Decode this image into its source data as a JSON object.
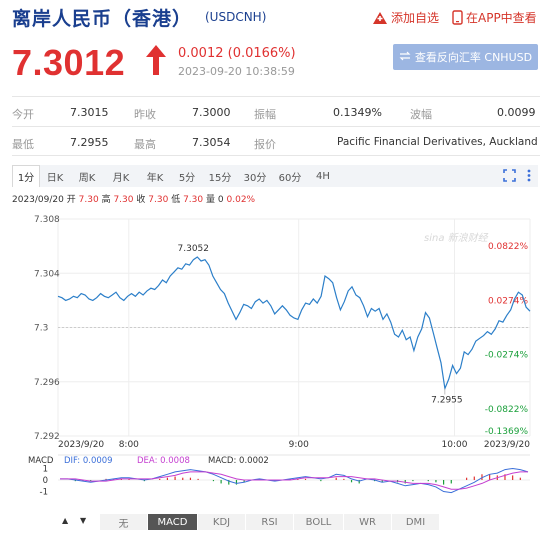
{
  "header": {
    "title": "离岸人民币（香港）",
    "symbol": "(USDCNH)",
    "add_watchlist": "添加自选",
    "app_view": "在APP中查看"
  },
  "quote": {
    "price": "7.3012",
    "change": "0.0012 (0.0166%)",
    "timestamp": "2023-09-20 10:38:59",
    "reverse_label": "查看反向汇率 CNHUSD",
    "up_color": "#e03131"
  },
  "stats": [
    [
      {
        "label": "今开",
        "value": "7.3015"
      },
      {
        "label": "昨收",
        "value": "7.3000"
      },
      {
        "label": "振幅",
        "value": "0.1349%"
      },
      {
        "label": "波幅",
        "value": "0.0099"
      }
    ],
    [
      {
        "label": "最低",
        "value": "7.2955"
      },
      {
        "label": "最高",
        "value": "7.3054"
      },
      {
        "label": "报价",
        "value": "Pacific Financial Derivatives, Auckland"
      }
    ]
  ],
  "tabs": [
    "1分",
    "日K",
    "周K",
    "月K",
    "年K",
    "5分",
    "15分",
    "30分",
    "60分",
    "4H"
  ],
  "active_tab": "1分",
  "info": {
    "date": "2023/09/20",
    "open_label": "开",
    "open": "7.30",
    "high_label": "高",
    "high": "7.30",
    "close_label": "收",
    "close": "7.30",
    "low_label": "低",
    "low": "7.30",
    "vol_label": "量",
    "vol": "0",
    "pct": "0.02%"
  },
  "chart_data": {
    "type": "line",
    "title": "",
    "y_ticks": [
      "7.308",
      "7.304",
      "7.3",
      "7.296",
      "7.292"
    ],
    "y_tick_values": [
      7.308,
      7.304,
      7.3,
      7.296,
      7.292
    ],
    "ylim": [
      7.292,
      7.308
    ],
    "pct_ticks": [
      "0.0822%",
      "0.0274%",
      "-0.0274%",
      "-0.0822%",
      "-0.1369%"
    ],
    "pct_tick_values": [
      7.306,
      7.302,
      7.298,
      7.294,
      7.292
    ],
    "x_ticks": [
      "2023/9/20",
      "8:00",
      "9:00",
      "10:00",
      "2023/9/20"
    ],
    "x_tick_positions": [
      0,
      0.15,
      0.51,
      0.84,
      1.0
    ],
    "high_label": "7.3052",
    "low_label": "7.2955",
    "prev_close": 7.3,
    "series": [
      {
        "values": [
          7.3023,
          7.3022,
          7.302,
          7.3021,
          7.3023,
          7.3022,
          7.3025,
          7.3024,
          7.3021,
          7.302,
          7.3022,
          7.3025,
          7.3023,
          7.3022,
          7.3024,
          7.3026,
          7.3022,
          7.302,
          7.3023,
          7.3025,
          7.3023,
          7.3026,
          7.3024,
          7.3027,
          7.3029,
          7.3028,
          7.3031,
          7.3035,
          7.3033,
          7.3038,
          7.3041,
          7.3044,
          7.3043,
          7.3047,
          7.3046,
          7.305,
          7.3052,
          7.3049,
          7.305,
          7.3046,
          7.3038,
          7.3033,
          7.3028,
          7.3025,
          7.3018,
          7.3012,
          7.3006,
          7.3011,
          7.3017,
          7.3016,
          7.3014,
          7.3019,
          7.3021,
          7.3018,
          7.302,
          7.3016,
          7.301,
          7.3013,
          7.3016,
          7.3013,
          7.3009,
          7.3007,
          7.3006,
          7.3013,
          7.3018,
          7.3017,
          7.3021,
          7.3018,
          7.3023,
          7.3038,
          7.3036,
          7.3033,
          7.3022,
          7.3013,
          7.3019,
          7.3027,
          7.303,
          7.3024,
          7.3022,
          7.3016,
          7.3008,
          7.3014,
          7.3012,
          7.3014,
          7.3006,
          7.301,
          7.3004,
          7.2995,
          7.2993,
          7.2998,
          7.2991,
          7.2993,
          7.2983,
          7.2993,
          7.2999,
          7.3011,
          7.3007,
          7.2996,
          7.2985,
          7.2974,
          7.2955,
          7.2962,
          7.2972,
          7.2966,
          7.297,
          7.2982,
          7.298,
          7.2984,
          7.299,
          7.2992,
          7.2994,
          7.2997,
          7.2995,
          7.2999,
          7.3005,
          7.3004,
          7.3009,
          7.3013,
          7.3021,
          7.3026,
          7.3024,
          7.3015,
          7.3012
        ]
      }
    ]
  },
  "macd": {
    "label": "MACD",
    "dif_label": "DIF: 0.0009",
    "dea_label": "DEA: 0.0008",
    "macd_label": "MACD: 0.0002",
    "y_ticks": [
      "1",
      "0",
      "-1"
    ],
    "dif": [
      0.1,
      0.1,
      0.0,
      -0.1,
      -0.2,
      -0.1,
      0.0,
      0.1,
      0.2,
      0.2,
      0.1,
      0.0,
      0.1,
      0.3,
      0.5,
      0.7,
      0.8,
      0.9,
      0.8,
      0.7,
      0.5,
      0.2,
      -0.1,
      -0.3,
      -0.2,
      0.0,
      0.1,
      0.0,
      -0.1,
      0.0,
      0.1,
      0.2,
      0.3,
      0.2,
      0.1,
      0.2,
      0.5,
      0.4,
      0.1,
      -0.1,
      0.1,
      0.0,
      -0.2,
      -0.1,
      -0.3,
      -0.5,
      -0.4,
      -0.3,
      -0.4,
      -0.6,
      -1.0,
      -1.1,
      -0.8,
      -0.5,
      -0.2,
      0.2,
      0.5,
      0.6,
      0.9,
      1.0,
      0.9,
      0.7
    ],
    "dea": [
      0.1,
      0.1,
      0.1,
      0.0,
      -0.1,
      -0.1,
      -0.1,
      0.0,
      0.1,
      0.1,
      0.1,
      0.1,
      0.1,
      0.2,
      0.3,
      0.4,
      0.6,
      0.7,
      0.7,
      0.7,
      0.6,
      0.5,
      0.3,
      0.1,
      0.0,
      0.0,
      0.0,
      0.0,
      0.0,
      0.0,
      0.0,
      0.1,
      0.2,
      0.2,
      0.2,
      0.2,
      0.3,
      0.3,
      0.3,
      0.2,
      0.1,
      0.1,
      0.0,
      -0.1,
      -0.1,
      -0.2,
      -0.3,
      -0.3,
      -0.3,
      -0.4,
      -0.6,
      -0.8,
      -0.8,
      -0.7,
      -0.5,
      -0.3,
      0.0,
      0.2,
      0.4,
      0.6,
      0.7,
      0.7
    ],
    "hist": [
      0.0,
      0.0,
      -0.1,
      -0.1,
      -0.1,
      0.0,
      0.1,
      0.1,
      0.1,
      0.1,
      0.0,
      -0.1,
      0.0,
      0.1,
      0.2,
      0.3,
      0.2,
      0.2,
      0.1,
      0.0,
      -0.1,
      -0.3,
      -0.4,
      -0.4,
      -0.2,
      0.0,
      0.1,
      0.0,
      -0.1,
      0.0,
      0.1,
      0.1,
      0.1,
      0.0,
      -0.1,
      0.0,
      0.2,
      0.1,
      -0.2,
      -0.3,
      0.0,
      -0.1,
      -0.2,
      0.0,
      -0.2,
      -0.3,
      -0.1,
      0.0,
      -0.1,
      -0.2,
      -0.4,
      -0.3,
      0.0,
      0.2,
      0.3,
      0.5,
      0.5,
      0.4,
      0.5,
      0.4,
      0.2,
      0.0
    ],
    "dif_color": "#3b6fd9",
    "dea_color": "#c53fd0",
    "hist_up_color": "#e03131",
    "hist_down_color": "#1a9f3a"
  },
  "indicator_tabs": [
    "无",
    "MACD",
    "KDJ",
    "RSI",
    "BOLL",
    "WR",
    "DMI"
  ],
  "active_indicator": "MACD",
  "nav": {
    "left": "▲",
    "right": "▼"
  },
  "colors": {
    "line": "#2c7fc9",
    "accent": "#1a3f8f"
  }
}
